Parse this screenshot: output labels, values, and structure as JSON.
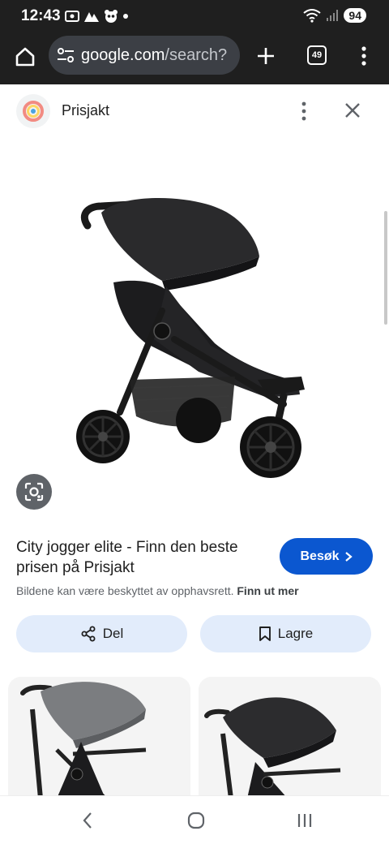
{
  "status_bar": {
    "time": "12:43",
    "battery": "94"
  },
  "browser": {
    "url_host": "google.com",
    "url_path": "/search?",
    "tab_count": "49"
  },
  "source": {
    "name": "Prisjakt"
  },
  "result": {
    "title": "City jogger elite - Finn den beste prisen på Prisjakt",
    "visit_label": "Besøk",
    "copyright_text": "Bildene kan være beskyttet av opphavsrett.",
    "copyright_link": "Finn ut mer"
  },
  "actions": {
    "share_label": "Del",
    "save_label": "Lagre"
  },
  "icons": {
    "home": "home-icon",
    "site_settings": "tune-icon",
    "new_tab": "plus-icon",
    "menu": "more-vert-icon",
    "close": "close-icon",
    "lens": "lens-icon",
    "share": "share-icon",
    "save": "bookmark-icon",
    "back": "back-icon",
    "home_nav": "home-nav-icon",
    "recents": "recents-icon"
  },
  "colors": {
    "accent": "#0b57d0",
    "chip_bg": "#e2ecfb",
    "browser_bar": "#1f1f1f",
    "url_box": "#3c3f45"
  }
}
